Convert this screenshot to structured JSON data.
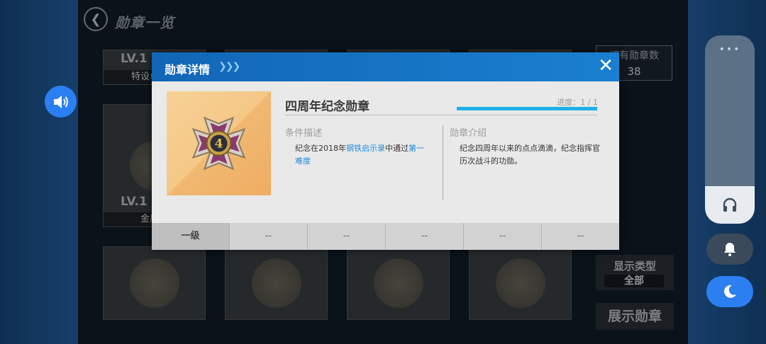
{
  "header": {
    "title": "勋章一览",
    "back_icon": "back-icon"
  },
  "grid": {
    "slots": [
      {
        "level": "LV.1",
        "name": "特设卓越作"
      },
      {
        "level": "LV.1",
        "name": "金质火"
      }
    ]
  },
  "sidebar": {
    "owned_label": "拥有勋章数",
    "owned_count": "38",
    "display_type_label": "显示类型",
    "display_type_value": "全部",
    "show_medal_label": "展示勋章"
  },
  "dialog": {
    "title": "勋章详情",
    "close_icon": "close-icon",
    "medal_name": "四周年纪念勋章",
    "progress_label": "进度：1 / 1",
    "progress_fraction": 1.0,
    "condition_heading": "条件描述",
    "condition_pre": "纪念在2018年",
    "condition_link1": "钢铁启示录",
    "condition_mid": "中通过",
    "condition_link2": "第一难度",
    "intro_heading": "勋章介绍",
    "intro_text": "纪念四周年以来的点点滴滴，纪念指挥官历次战斗的功勋。",
    "medal_number": "4",
    "tiers": [
      "一级",
      "--",
      "--",
      "--",
      "--",
      "--"
    ]
  },
  "colors": {
    "accent": "#1a7fd0",
    "progress": "#1fb0e8",
    "link": "#1e8ad6"
  }
}
